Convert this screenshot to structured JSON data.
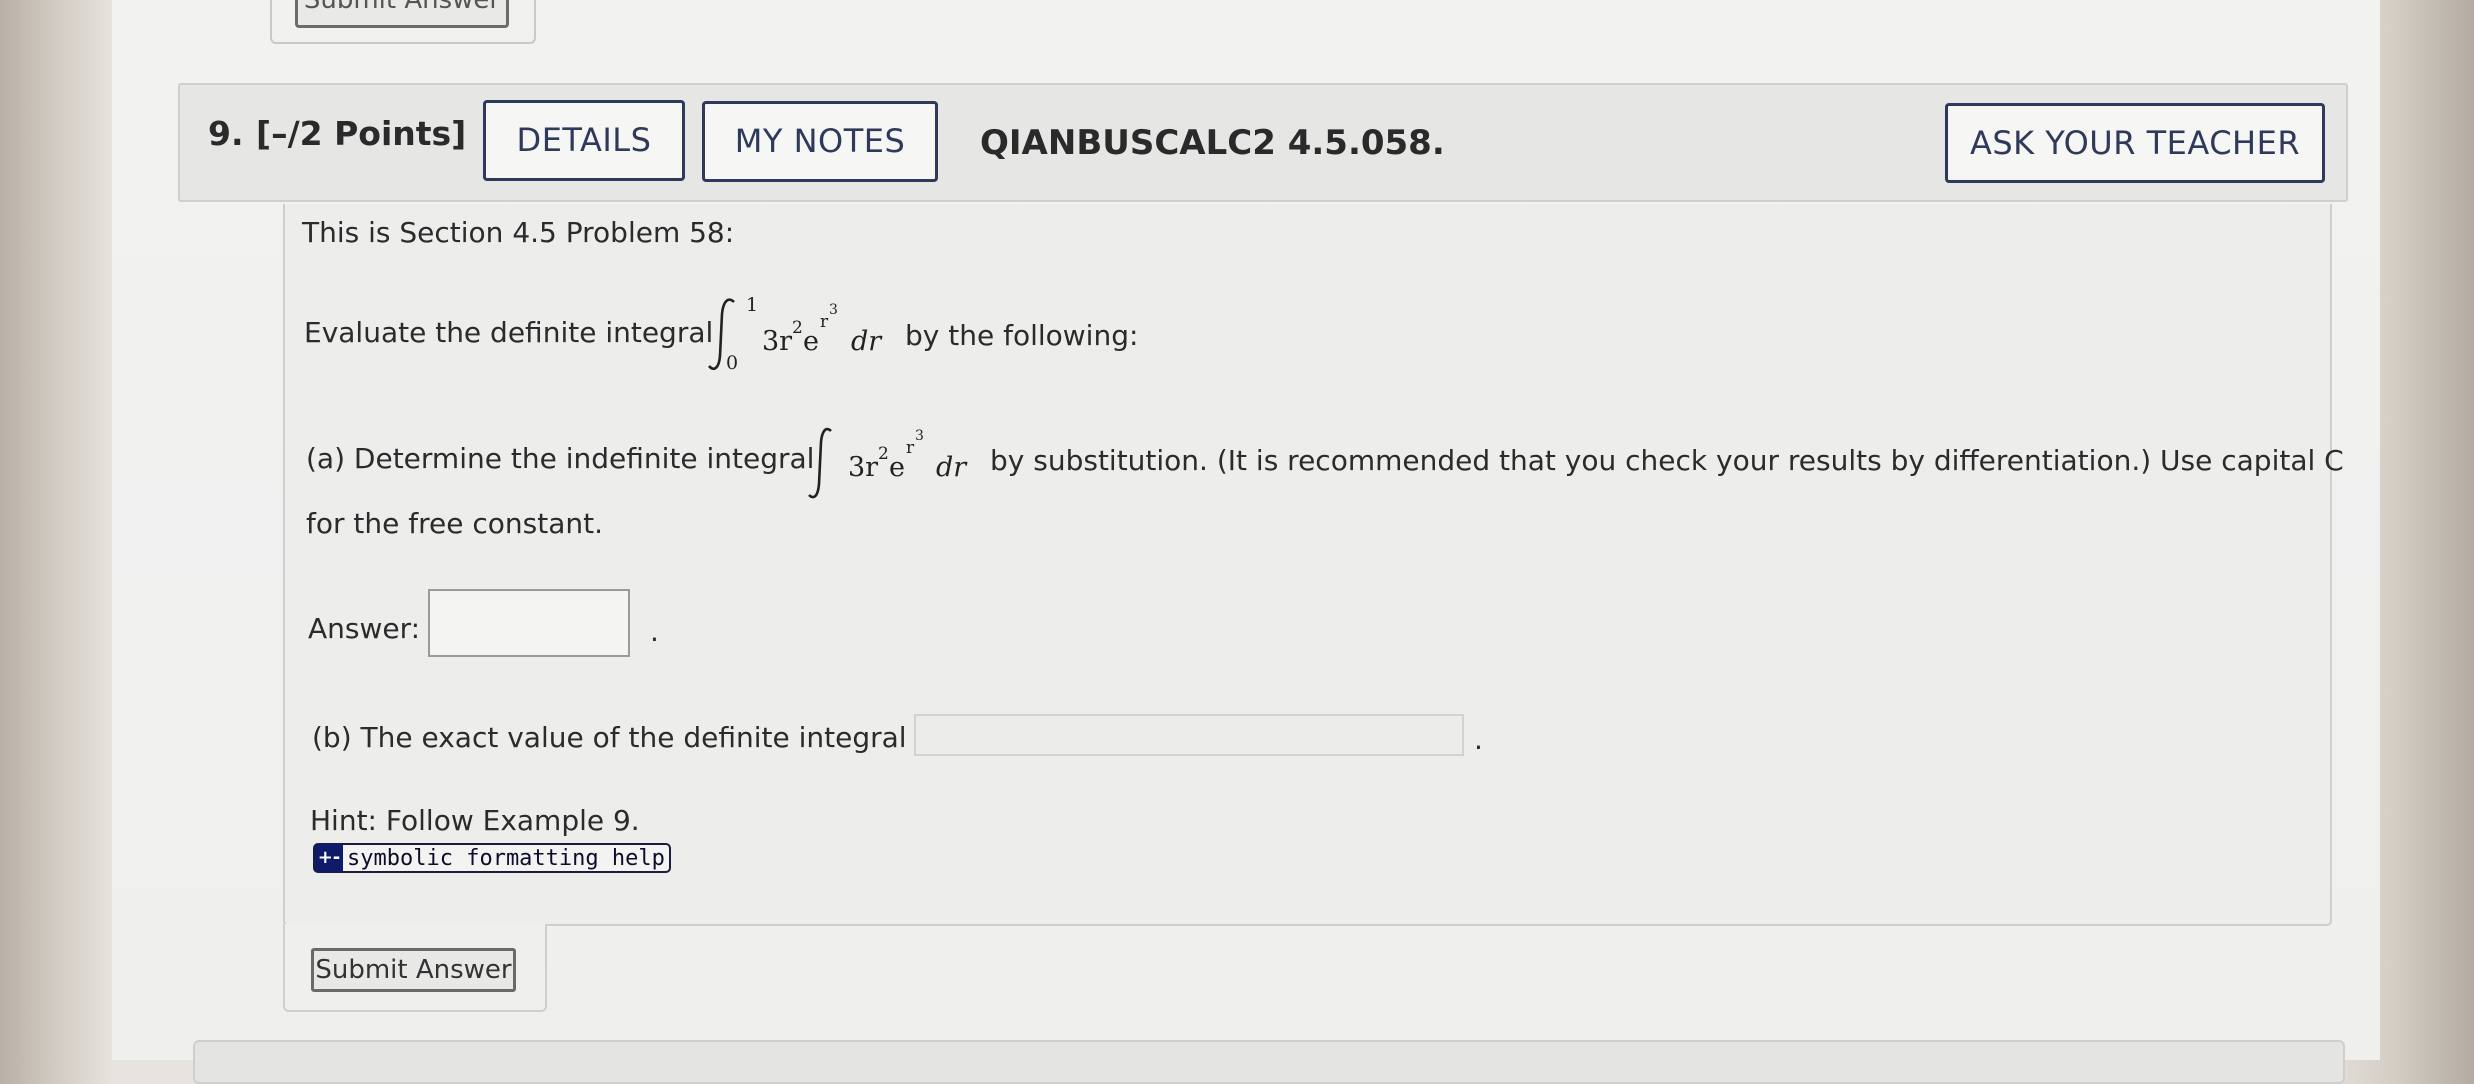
{
  "prev": {
    "submit_label": "Submit Answer"
  },
  "question": {
    "number": "9.",
    "points": "[–/2 Points]",
    "details_label": "DETAILS",
    "my_notes_label": "MY NOTES",
    "code": "QIANBUSCALC2 4.5.058.",
    "ask_teacher_label": "ASK YOUR TEACHER"
  },
  "body": {
    "intro": "This is Section 4.5 Problem 58:",
    "evaluate_prefix": "Evaluate the definite integral",
    "evaluate_suffix": "by the following:",
    "integral": {
      "lower": "0",
      "upper": "1",
      "coef": "3r",
      "sq": "2",
      "e": "e",
      "exp_base": "r",
      "exp_pow": "3",
      "dr": "dr"
    },
    "part_a_prefix": "(a) Determine the indefinite integral",
    "part_a_suffix": "by substitution. (It is recommended that you check your results by differentiation.) Use capital C",
    "part_a_line2": "for the free constant.",
    "answer_label": "Answer:",
    "answer_a_value": "",
    "period": ".",
    "part_b": "(b) The exact value of the definite integral is",
    "answer_b_value": "",
    "hint": "Hint: Follow Example 9.",
    "help_icon": "+-",
    "help_label": "symbolic formatting help"
  },
  "footer": {
    "submit_label": "Submit Answer"
  }
}
